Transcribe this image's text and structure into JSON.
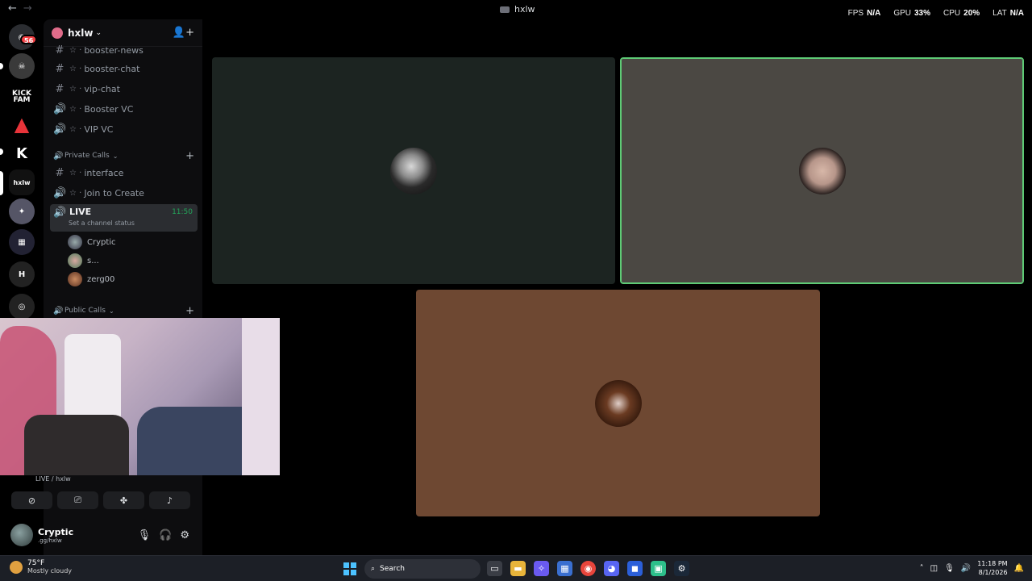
{
  "window": {
    "title": "hxlw",
    "back": "←",
    "forward": "→"
  },
  "overlay_stats": {
    "fps_label": "FPS",
    "fps_value": "N/A",
    "gpu_label": "GPU",
    "gpu_value": "33%",
    "cpu_label": "CPU",
    "cpu_value": "20%",
    "lat_label": "LAT",
    "lat_value": "N/A"
  },
  "rail": {
    "dm_badge": "56",
    "servers": [
      "KICK FAM",
      "hxlw"
    ]
  },
  "server": {
    "name": "hxlw",
    "chevron": "⌄",
    "invite_icon": "👤+"
  },
  "channels_top": [
    {
      "type": "text",
      "label": "booster-news"
    },
    {
      "type": "text",
      "label": "booster-chat"
    },
    {
      "type": "text",
      "label": "vip-chat"
    },
    {
      "type": "voice",
      "label": "Booster VC"
    },
    {
      "type": "voice",
      "label": "VIP VC"
    }
  ],
  "categories": {
    "private": "Private Calls",
    "public": "Public Calls"
  },
  "private_channels": [
    {
      "type": "text",
      "label": "interface"
    },
    {
      "type": "voice",
      "label": "Join to Create"
    }
  ],
  "live_channel": {
    "label": "LIVE",
    "timer": "11:50",
    "status": "Set a channel status"
  },
  "voice_users": [
    {
      "name": "Cryptic"
    },
    {
      "name": "s..."
    },
    {
      "name": "zerg00"
    }
  ],
  "voice_panel": {
    "connection": "LIVE / hxlw"
  },
  "user": {
    "name": "Cryptic",
    "status": ".gg/hxlw"
  },
  "taskbar": {
    "temp": "75°F",
    "condition": "Mostly cloudy",
    "search": "Search",
    "time": "11:18 PM",
    "date": "8/1/2026"
  },
  "colors": {
    "speaking_border": "#5eca75",
    "tile1": "#1c2421",
    "tile2": "#4b4843",
    "tile3": "#6e4832",
    "live_green": "#23a55a"
  }
}
